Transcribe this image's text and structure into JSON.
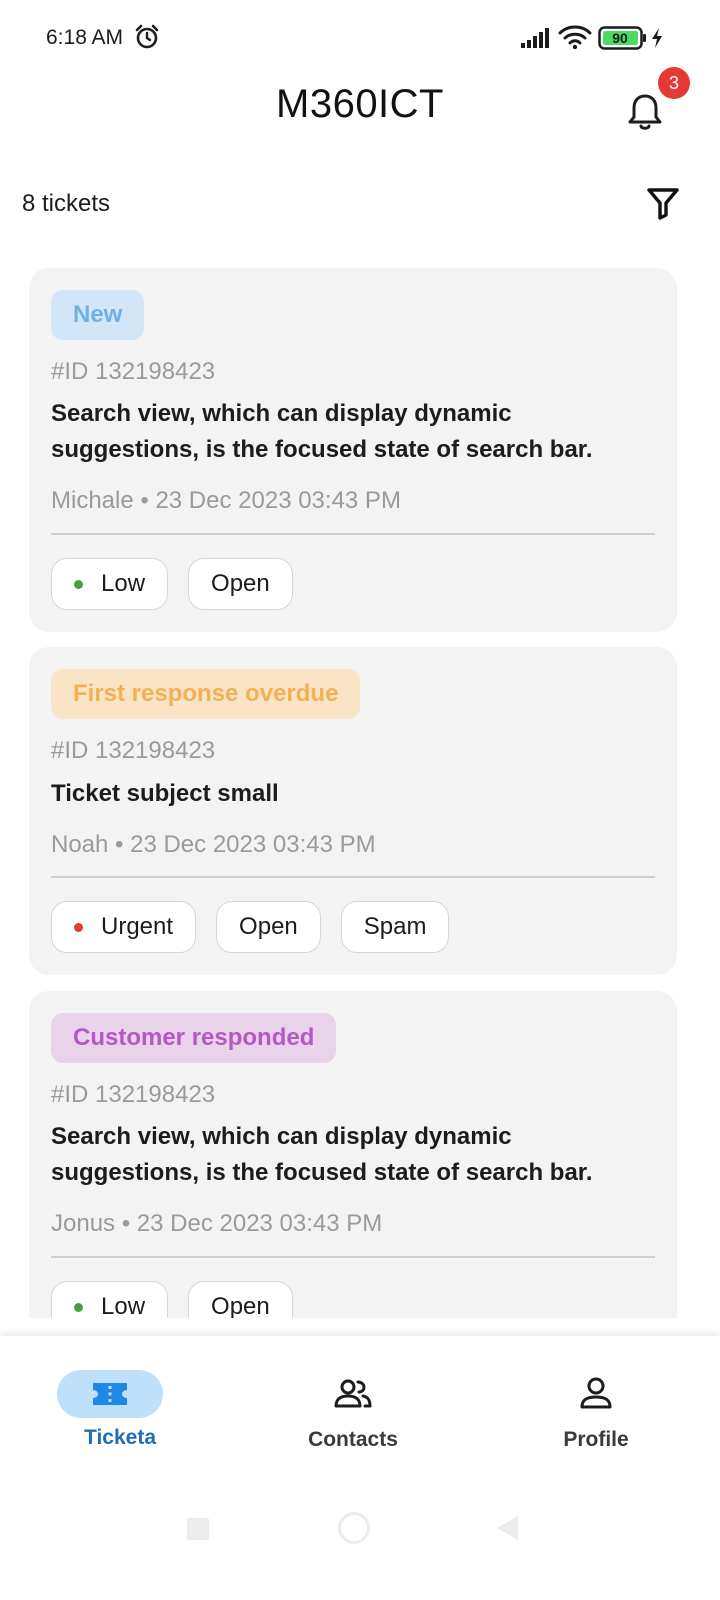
{
  "status_bar": {
    "time": "6:18 AM",
    "battery": "90"
  },
  "header": {
    "title": "M360ICT",
    "notification_count": "3"
  },
  "list": {
    "count_label": "8 tickets"
  },
  "colors": {
    "low_dot": "#43a047",
    "urgent_dot": "#e53935",
    "nav_active": "#1e6fb5",
    "nav_inactive": "#3a3a3a"
  },
  "tickets": [
    {
      "status": "New",
      "status_bg": "#d3e6f7",
      "status_color": "#6fb0e6",
      "id": "#ID 132198423",
      "subject": "Search view, which can display dynamic suggestions, is the focused state of search bar.",
      "meta": "Michale • 23 Dec 2023 03:43 PM",
      "priority": "Low",
      "tags": [
        "Open"
      ]
    },
    {
      "status": "First response overdue",
      "status_bg": "#fae4c6",
      "status_color": "#f4b055",
      "id": "#ID 132198423",
      "subject": "Ticket subject small",
      "meta": "Noah • 23 Dec 2023 03:43 PM",
      "priority": "Urgent",
      "tags": [
        "Open",
        "Spam"
      ]
    },
    {
      "status": "Customer responded",
      "status_bg": "#e8d3ea",
      "status_color": "#b459c4",
      "id": "#ID 132198423",
      "subject": "Search view, which can display dynamic suggestions, is the focused state of search bar.",
      "meta": "Jonus • 23 Dec 2023 03:43 PM",
      "priority": "Low",
      "tags": [
        "Open"
      ]
    }
  ],
  "bottom_nav": {
    "items": [
      {
        "label": "Ticketa",
        "icon": "ticket-icon",
        "active": true
      },
      {
        "label": "Contacts",
        "icon": "contacts-icon",
        "active": false
      },
      {
        "label": "Profile",
        "icon": "profile-icon",
        "active": false
      }
    ]
  }
}
